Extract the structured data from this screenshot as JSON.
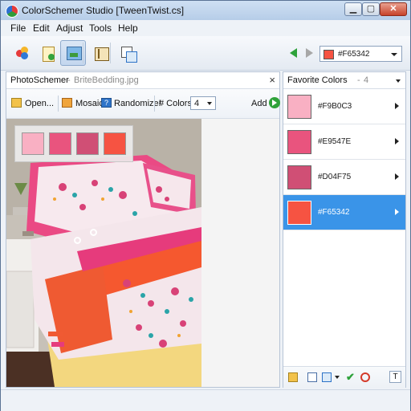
{
  "window": {
    "title": "ColorSchemer Studio [TweenTwist.cs]"
  },
  "menu": [
    "File",
    "Edit",
    "Adjust",
    "Tools",
    "Help"
  ],
  "toolbar": {
    "buttons": [
      "color-wheel-icon",
      "document-icon",
      "photo-schemer-icon",
      "panel-icon",
      "gallery-icon"
    ],
    "selected_color": "#F65342"
  },
  "photoschemer": {
    "title": "PhotoSchemer",
    "filename": "BriteBedding.jpg",
    "open_label": "Open...",
    "mosaic_label": "Mosaic",
    "randomize_label": "Randomize!",
    "colors_label": "# Colors:",
    "colors_value": "4",
    "add_label": "Add",
    "swatches": [
      "#F9B0C3",
      "#E9547E",
      "#D04F75",
      "#F65342"
    ]
  },
  "favorites": {
    "title": "Favorite Colors",
    "count": "4",
    "items": [
      {
        "label": "#F9B0C3",
        "color": "#F9B0C3"
      },
      {
        "label": "#E9547E",
        "color": "#E9547E"
      },
      {
        "label": "#D04F75",
        "color": "#D04F75"
      },
      {
        "label": "#F65342",
        "color": "#F65342"
      }
    ],
    "selected_index": 3
  },
  "colors": {
    "accent": "#3A94E8"
  }
}
